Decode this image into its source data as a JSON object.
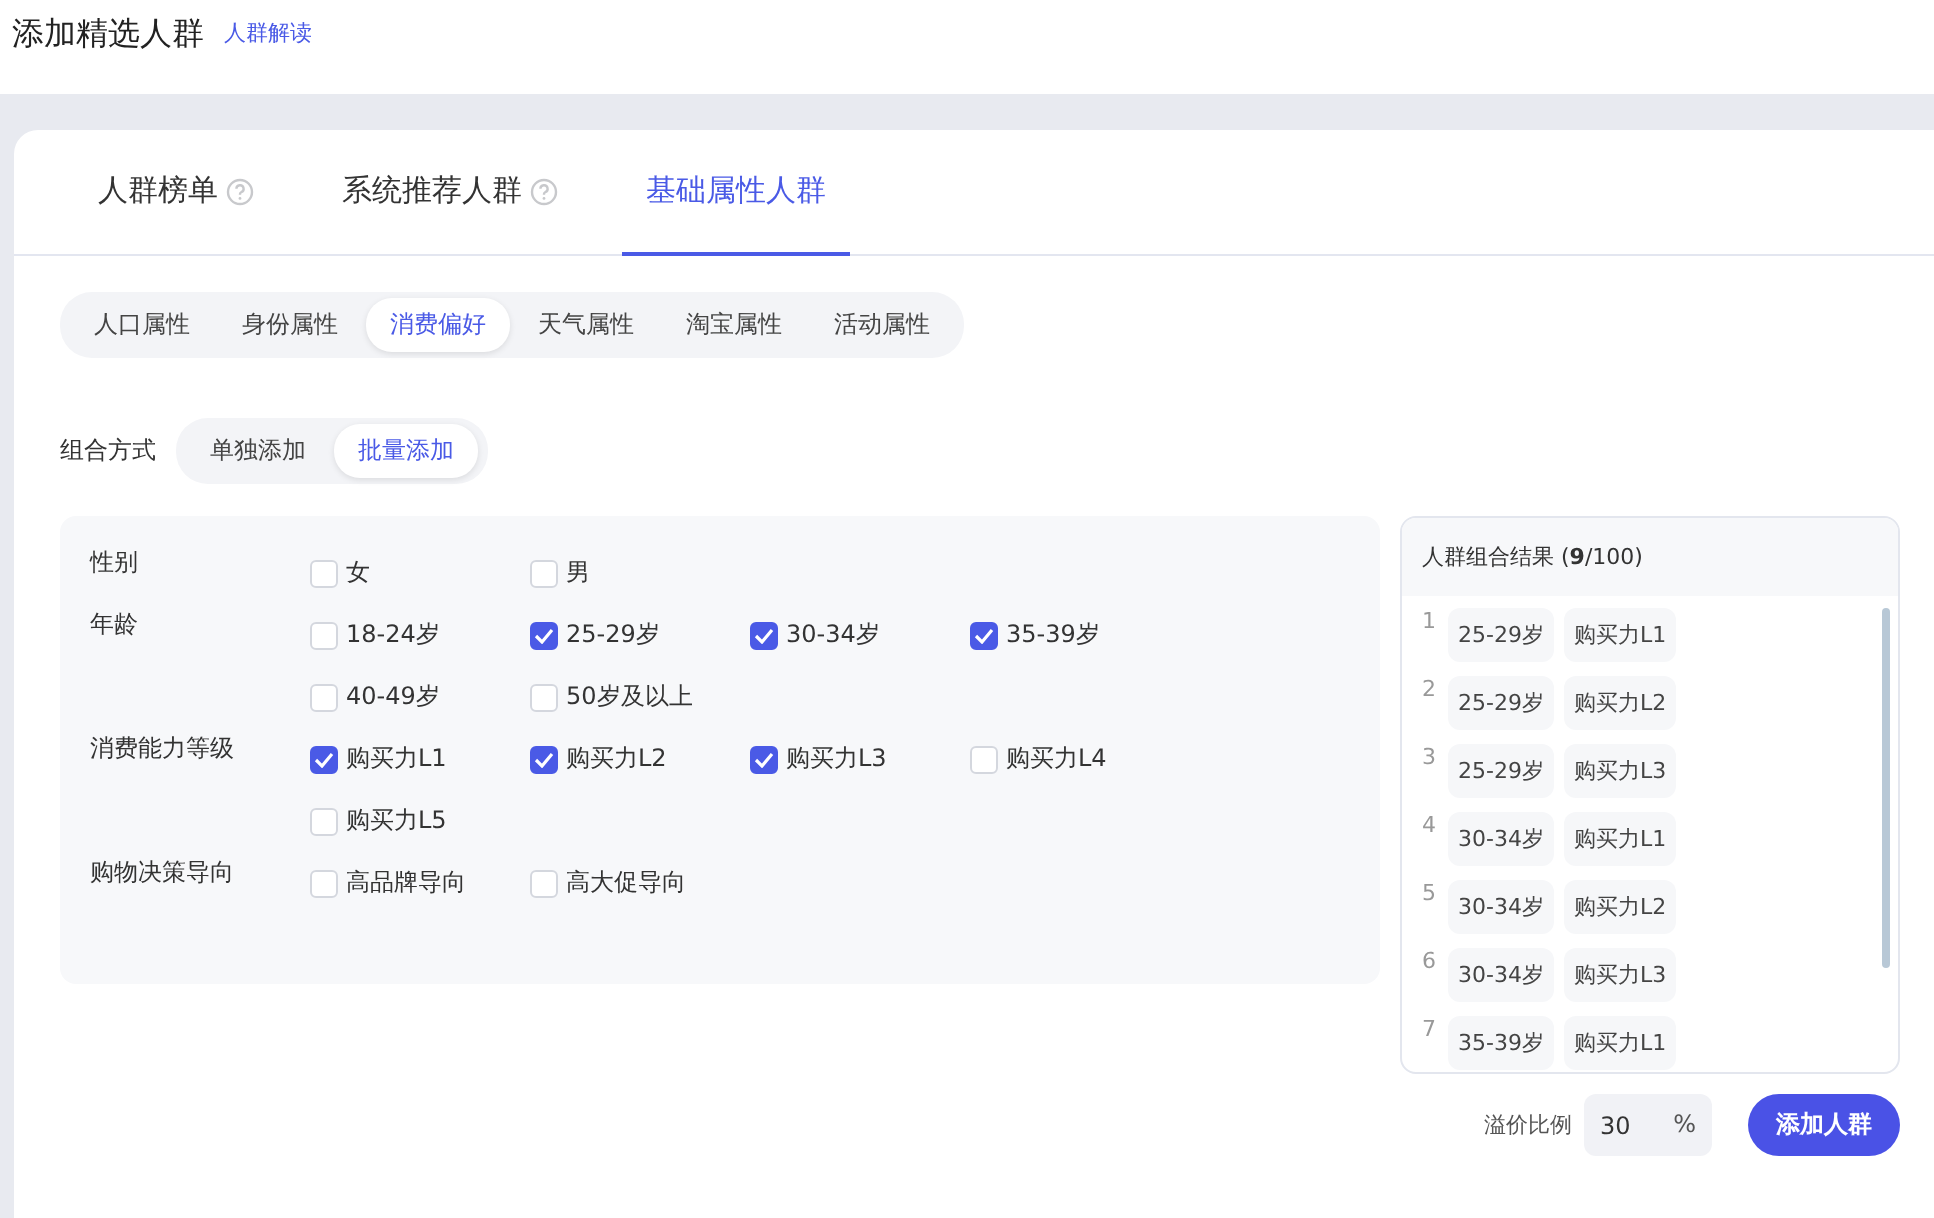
{
  "page": {
    "title": "添加精选人群",
    "link": "人群解读"
  },
  "tabs": [
    {
      "label": "人群榜单",
      "help": true,
      "selected": false
    },
    {
      "label": "系统推荐人群",
      "help": true,
      "selected": false
    },
    {
      "label": "基础属性人群",
      "help": false,
      "selected": true
    }
  ],
  "subtabs": [
    {
      "label": "人口属性",
      "selected": false
    },
    {
      "label": "身份属性",
      "selected": false
    },
    {
      "label": "消费偏好",
      "selected": true
    },
    {
      "label": "天气属性",
      "selected": false
    },
    {
      "label": "淘宝属性",
      "selected": false
    },
    {
      "label": "活动属性",
      "selected": false
    }
  ],
  "combine": {
    "label": "组合方式",
    "options": [
      {
        "label": "单独添加",
        "selected": false
      },
      {
        "label": "批量添加",
        "selected": true
      }
    ]
  },
  "attributes": [
    {
      "label": "性别",
      "options": [
        {
          "label": "女",
          "checked": false
        },
        {
          "label": "男",
          "checked": false
        }
      ]
    },
    {
      "label": "年龄",
      "options": [
        {
          "label": "18-24岁",
          "checked": false
        },
        {
          "label": "25-29岁",
          "checked": true
        },
        {
          "label": "30-34岁",
          "checked": true
        },
        {
          "label": "35-39岁",
          "checked": true
        },
        {
          "label": "40-49岁",
          "checked": false
        },
        {
          "label": "50岁及以上",
          "checked": false
        }
      ]
    },
    {
      "label": "消费能力等级",
      "options": [
        {
          "label": "购买力L1",
          "checked": true
        },
        {
          "label": "购买力L2",
          "checked": true
        },
        {
          "label": "购买力L3",
          "checked": true
        },
        {
          "label": "购买力L4",
          "checked": false
        },
        {
          "label": "购买力L5",
          "checked": false
        }
      ]
    },
    {
      "label": "购物决策导向",
      "options": [
        {
          "label": "高品牌导向",
          "checked": false
        },
        {
          "label": "高大促导向",
          "checked": false
        }
      ]
    }
  ],
  "results": {
    "title": "人群组合结果 (**9**/100)",
    "rows": [
      {
        "index": "1",
        "tags": [
          "25-29岁",
          "购买力L1"
        ]
      },
      {
        "index": "2",
        "tags": [
          "25-29岁",
          "购买力L2"
        ]
      },
      {
        "index": "3",
        "tags": [
          "25-29岁",
          "购买力L3"
        ]
      },
      {
        "index": "4",
        "tags": [
          "30-34岁",
          "购买力L1"
        ]
      },
      {
        "index": "5",
        "tags": [
          "30-34岁",
          "购买力L2"
        ]
      },
      {
        "index": "6",
        "tags": [
          "30-34岁",
          "购买力L3"
        ]
      },
      {
        "index": "7",
        "tags": [
          "35-39岁",
          "购买力L1"
        ]
      }
    ]
  },
  "premium": {
    "label": "溢价比例",
    "value": "30",
    "unit": "%"
  },
  "submit": "添加人群"
}
